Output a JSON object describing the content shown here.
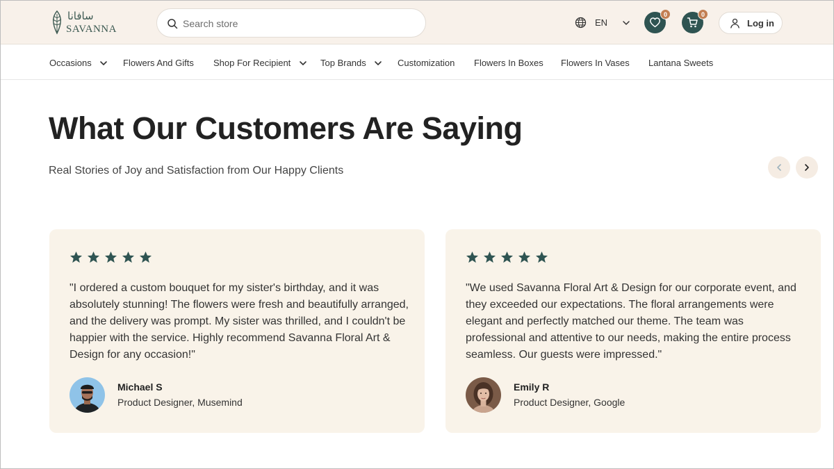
{
  "header": {
    "logo": {
      "arabic": "سافانا",
      "english": "SAVANNA"
    },
    "search": {
      "placeholder": "Search store",
      "value": ""
    },
    "language": "EN",
    "wishlist_count": "0",
    "cart_count": "0",
    "login_label": "Log in"
  },
  "nav": {
    "items": [
      {
        "label": "Occasions",
        "has_dropdown": true
      },
      {
        "label": "Flowers And Gifts",
        "has_dropdown": false
      },
      {
        "label": "Shop For Recipient",
        "has_dropdown": true
      },
      {
        "label": "Top Brands",
        "has_dropdown": true
      },
      {
        "label": "Customization",
        "has_dropdown": false
      },
      {
        "label": "Flowers In Boxes",
        "has_dropdown": false
      },
      {
        "label": "Flowers In Vases",
        "has_dropdown": false
      },
      {
        "label": "Lantana Sweets",
        "has_dropdown": false
      }
    ]
  },
  "section": {
    "title": "What Our Customers Are Saying",
    "subtitle": "Real Stories of Joy and Satisfaction from Our Happy Clients"
  },
  "testimonials": [
    {
      "rating": 5,
      "quote": "\"I ordered a custom bouquet for my sister's birthday, and it was absolutely stunning! The flowers were fresh and beautifully arranged, and the delivery was prompt. My sister was thrilled, and I couldn't be happier with the service. Highly recommend Savanna Floral Art & Design for any occasion!\"",
      "name": "Michael S",
      "role": "Product Designer, Musemind"
    },
    {
      "rating": 5,
      "quote": "\"We used Savanna Floral Art & Design for our corporate event, and they exceeded our expectations. The floral arrangements were elegant and perfectly matched our theme. The team was professional and attentive to our needs, making the entire process seamless. Our guests were impressed.\"",
      "name": "Emily R",
      "role": "Product Designer, Google"
    }
  ],
  "colors": {
    "header_bg": "#f8f1ea",
    "accent": "#2f5452",
    "badge": "#c27e52",
    "card_bg": "#f9f3e9",
    "star": "#2f5452"
  },
  "icons": {
    "search": "search-icon",
    "language": "globe-icon",
    "wishlist": "heart-icon",
    "cart": "cart-icon",
    "login": "user-icon",
    "prev": "chevron-left-icon",
    "next": "chevron-right-icon"
  }
}
